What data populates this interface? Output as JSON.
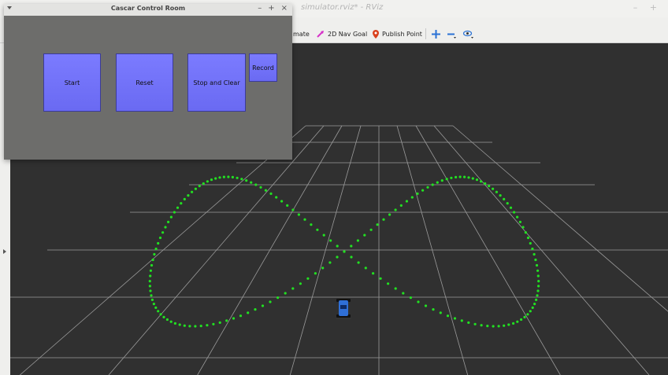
{
  "rviz": {
    "title": "simulator.rviz* - RViz",
    "window_controls": "– +",
    "toolbar": {
      "partial_tool_label": "mate",
      "nav_goal_label": "2D Nav Goal",
      "publish_point_label": "Publish Point",
      "nav_goal_color": "#d633c9",
      "publish_point_color": "#d9411e",
      "accent": "#2a72d5"
    }
  },
  "control_window": {
    "title": "Cascar Control Room",
    "window_controls": [
      "–",
      "+",
      "×"
    ],
    "buttons": {
      "start": "Start",
      "reset": "Reset",
      "stop_and_clear": "Stop and Clear",
      "record": "Record"
    },
    "button_color": "#7373fb"
  },
  "scene": {
    "grid_color": "#a0a0a0",
    "path_color": "#22e022",
    "background": "#303030",
    "robot_color": "#2f6fd6"
  }
}
